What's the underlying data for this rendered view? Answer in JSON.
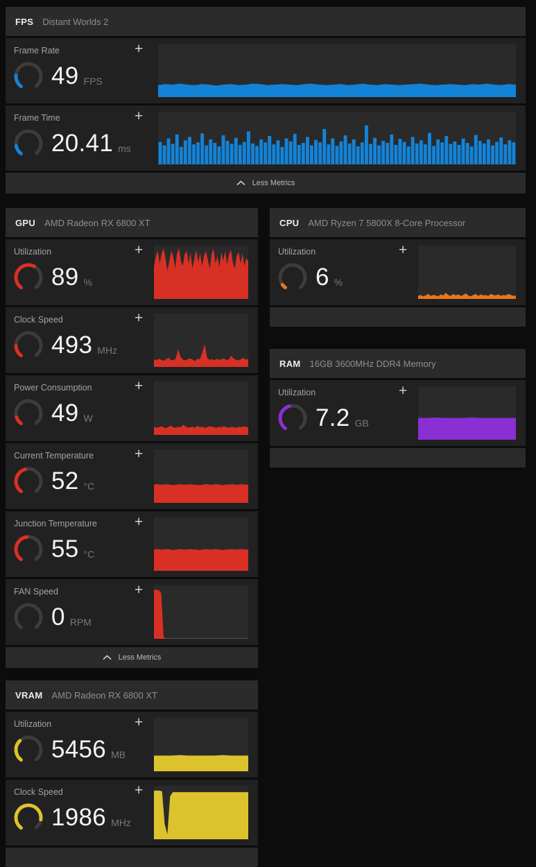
{
  "icons": {
    "plus": "+"
  },
  "panels": {
    "fps": {
      "title": "FPS",
      "subtitle": "Distant Worlds 2",
      "less_metrics_label": "Less Metrics",
      "metrics": {
        "frame_rate": {
          "label": "Frame Rate",
          "value": "49",
          "unit": "FPS",
          "color": "#1383d8",
          "gauge": 0.2,
          "style": "area",
          "series": [
            0.24,
            0.26,
            0.25,
            0.27,
            0.25,
            0.24,
            0.26,
            0.25,
            0.23,
            0.25,
            0.26,
            0.24,
            0.25,
            0.27,
            0.26,
            0.24,
            0.25,
            0.26,
            0.25,
            0.24,
            0.26,
            0.27,
            0.25,
            0.24,
            0.25,
            0.26,
            0.24,
            0.25,
            0.27,
            0.25,
            0.24,
            0.26,
            0.25,
            0.24,
            0.25,
            0.26,
            0.27,
            0.25,
            0.24,
            0.25,
            0.26,
            0.25,
            0.24,
            0.26,
            0.25,
            0.27,
            0.25,
            0.24,
            0.26,
            0.25
          ]
        },
        "frame_time": {
          "label": "Frame Time",
          "value": "20.41",
          "unit": "ms",
          "color": "#1383d8",
          "gauge": 0.15,
          "style": "bars",
          "series": [
            0.45,
            0.38,
            0.52,
            0.41,
            0.6,
            0.35,
            0.48,
            0.55,
            0.4,
            0.44,
            0.62,
            0.38,
            0.5,
            0.43,
            0.36,
            0.58,
            0.47,
            0.41,
            0.53,
            0.39,
            0.45,
            0.66,
            0.42,
            0.37,
            0.5,
            0.44,
            0.57,
            0.4,
            0.48,
            0.35,
            0.52,
            0.46,
            0.61,
            0.39,
            0.43,
            0.55,
            0.38,
            0.49,
            0.44,
            0.71,
            0.4,
            0.52,
            0.37,
            0.46,
            0.58,
            0.42,
            0.5,
            0.36,
            0.44,
            0.78,
            0.41,
            0.53,
            0.38,
            0.47,
            0.43,
            0.6,
            0.39,
            0.51,
            0.45,
            0.36,
            0.55,
            0.42,
            0.48,
            0.4,
            0.63,
            0.37,
            0.5,
            0.44,
            0.57,
            0.41,
            0.46,
            0.39,
            0.52,
            0.43,
            0.36,
            0.59,
            0.47,
            0.42,
            0.5,
            0.38,
            0.45,
            0.54,
            0.4,
            0.48,
            0.44
          ]
        }
      }
    },
    "gpu": {
      "title": "GPU",
      "subtitle": "AMD Radeon RX 6800 XT",
      "less_metrics_label": "Less Metrics",
      "metrics": {
        "utilization": {
          "label": "Utilization",
          "value": "89",
          "unit": "%",
          "color": "#d93025",
          "gauge": 0.6,
          "style": "area",
          "series": [
            0.62,
            0.85,
            0.95,
            0.7,
            0.9,
            1.0,
            0.8,
            0.55,
            0.75,
            0.95,
            0.85,
            0.6,
            0.9,
            1.0,
            0.75,
            0.65,
            0.88,
            0.95,
            0.7,
            0.92,
            0.6,
            0.8,
            0.97,
            0.72,
            0.9,
            0.65,
            0.85,
            0.95,
            0.78,
            0.6,
            0.9,
            0.99,
            0.7,
            0.85,
            0.62,
            0.92,
            0.75,
            0.95,
            0.68,
            0.88,
            0.97,
            0.72,
            0.6,
            0.85,
            0.93,
            0.7,
            0.9,
            0.65,
            0.8,
            0.75
          ]
        },
        "clock_speed": {
          "label": "Clock Speed",
          "value": "493",
          "unit": "MHz",
          "color": "#d93025",
          "gauge": 0.18,
          "style": "area",
          "series": [
            0.15,
            0.13,
            0.16,
            0.14,
            0.12,
            0.15,
            0.18,
            0.14,
            0.13,
            0.16,
            0.35,
            0.2,
            0.14,
            0.13,
            0.15,
            0.17,
            0.14,
            0.12,
            0.16,
            0.15,
            0.28,
            0.45,
            0.18,
            0.14,
            0.15,
            0.13,
            0.16,
            0.14,
            0.15,
            0.17,
            0.13,
            0.15,
            0.22,
            0.16,
            0.14,
            0.13,
            0.15,
            0.18,
            0.14,
            0.16
          ]
        },
        "power_consumption": {
          "label": "Power Consumption",
          "value": "49",
          "unit": "W",
          "color": "#d93025",
          "gauge": 0.12,
          "style": "area",
          "series": [
            0.16,
            0.14,
            0.15,
            0.17,
            0.15,
            0.13,
            0.16,
            0.18,
            0.15,
            0.14,
            0.16,
            0.15,
            0.2,
            0.17,
            0.14,
            0.15,
            0.16,
            0.14,
            0.18,
            0.15,
            0.16,
            0.14,
            0.15,
            0.17,
            0.16,
            0.15,
            0.14,
            0.16,
            0.15,
            0.17,
            0.15,
            0.14,
            0.16,
            0.15,
            0.14,
            0.16,
            0.15,
            0.17,
            0.16,
            0.15
          ]
        },
        "current_temperature": {
          "label": "Current Temperature",
          "value": "52",
          "unit": "°C",
          "color": "#d93025",
          "gauge": 0.45,
          "style": "area",
          "series": [
            0.36,
            0.37,
            0.36,
            0.36,
            0.37,
            0.36,
            0.35,
            0.36,
            0.37,
            0.36,
            0.36,
            0.37,
            0.36,
            0.36,
            0.35,
            0.36,
            0.37,
            0.36,
            0.36,
            0.37,
            0.36,
            0.35,
            0.36,
            0.36,
            0.37,
            0.36,
            0.36,
            0.37,
            0.36,
            0.36
          ]
        },
        "junction_temperature": {
          "label": "Junction Temperature",
          "value": "55",
          "unit": "°C",
          "color": "#d93025",
          "gauge": 0.48,
          "style": "area",
          "series": [
            0.42,
            0.43,
            0.42,
            0.42,
            0.43,
            0.42,
            0.41,
            0.42,
            0.43,
            0.42,
            0.42,
            0.43,
            0.42,
            0.42,
            0.41,
            0.42,
            0.43,
            0.42,
            0.42,
            0.43,
            0.42,
            0.41,
            0.42,
            0.42,
            0.43,
            0.42,
            0.42,
            0.43,
            0.42,
            0.42
          ]
        },
        "fan_speed": {
          "label": "FAN Speed",
          "value": "0",
          "unit": "RPM",
          "color": "#d93025",
          "gauge": 0,
          "style": "area",
          "series": [
            0.97,
            0.97,
            0.96,
            0.9,
            0.04,
            0,
            0,
            0,
            0,
            0,
            0,
            0,
            0,
            0,
            0,
            0,
            0,
            0,
            0,
            0,
            0,
            0,
            0,
            0,
            0,
            0,
            0,
            0,
            0,
            0,
            0,
            0,
            0,
            0,
            0,
            0,
            0,
            0,
            0,
            0
          ]
        }
      }
    },
    "cpu": {
      "title": "CPU",
      "subtitle": "AMD Ryzen 7 5800X 8-Core Processor",
      "metrics": {
        "utilization": {
          "label": "Utilization",
          "value": "6",
          "unit": "%",
          "color": "#e8761e",
          "gauge": 0.06,
          "style": "area",
          "series": [
            0.06,
            0.08,
            0.05,
            0.07,
            0.1,
            0.06,
            0.08,
            0.07,
            0.05,
            0.09,
            0.07,
            0.12,
            0.08,
            0.06,
            0.1,
            0.07,
            0.09,
            0.06,
            0.08,
            0.11,
            0.07,
            0.05,
            0.08,
            0.1,
            0.06,
            0.09,
            0.07,
            0.08,
            0.06,
            0.1,
            0.08,
            0.07,
            0.09,
            0.06,
            0.08,
            0.07,
            0.1,
            0.08,
            0.06,
            0.07
          ]
        }
      }
    },
    "ram": {
      "title": "RAM",
      "subtitle": "16GB 3600MHz DDR4 Memory",
      "metrics": {
        "utilization": {
          "label": "Utilization",
          "value": "7.2",
          "unit": "GB",
          "color": "#8a2fd4",
          "gauge": 0.45,
          "style": "area",
          "series": [
            0.43,
            0.43,
            0.44,
            0.43,
            0.43,
            0.43,
            0.44,
            0.43,
            0.43,
            0.43,
            0.43,
            0.43
          ]
        }
      }
    },
    "vram": {
      "title": "VRAM",
      "subtitle": "AMD Radeon RX 6800 XT",
      "metrics": {
        "utilization": {
          "label": "Utilization",
          "value": "5456",
          "unit": "MB",
          "color": "#dcc32e",
          "gauge": 0.35,
          "style": "area",
          "series": [
            0.31,
            0.31,
            0.31,
            0.32,
            0.31,
            0.31,
            0.31,
            0.31,
            0.32,
            0.31,
            0.31,
            0.31
          ]
        },
        "clock_speed": {
          "label": "Clock Speed",
          "value": "1986",
          "unit": "MHz",
          "color": "#dcc32e",
          "gauge": 0.85,
          "style": "area",
          "series": [
            0.96,
            0.96,
            0.96,
            0.95,
            0.3,
            0.1,
            0.85,
            0.93,
            0.93,
            0.93,
            0.93,
            0.93,
            0.93,
            0.93,
            0.93,
            0.93,
            0.93,
            0.93,
            0.93,
            0.93,
            0.93,
            0.93,
            0.93,
            0.93,
            0.93,
            0.93,
            0.93,
            0.93,
            0.93,
            0.93,
            0.93,
            0.93,
            0.93,
            0.93,
            0.93,
            0.93
          ]
        }
      }
    }
  }
}
